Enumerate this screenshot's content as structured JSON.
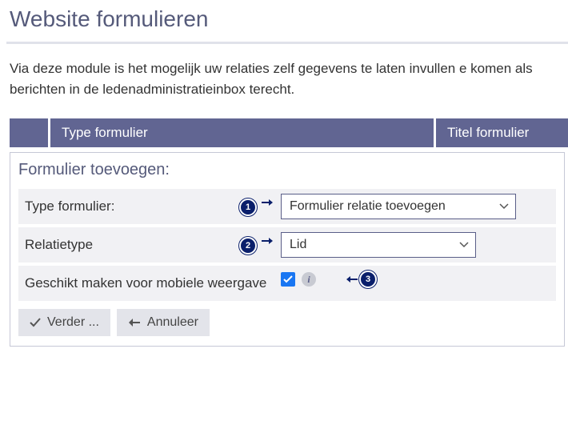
{
  "header": {
    "title": "Website formulieren",
    "intro": "Via deze module is het mogelijk uw relaties zelf gegevens te laten invullen e komen als berichten in de ledenadministratieinbox terecht."
  },
  "tabs": {
    "spacer": "",
    "type": "Type formulier",
    "title": "Titel formulier"
  },
  "form": {
    "heading": "Formulier toevoegen:",
    "row1": {
      "label": "Type formulier:",
      "value": "Formulier relatie toevoegen"
    },
    "row2": {
      "label": "Relatietype",
      "value": "Lid"
    },
    "row3": {
      "label": "Geschikt maken voor mobiele weergave",
      "checked": true
    }
  },
  "callouts": {
    "c1": "1",
    "c2": "2",
    "c3": "3"
  },
  "buttons": {
    "next": "Verder ...",
    "cancel": "Annuleer"
  }
}
